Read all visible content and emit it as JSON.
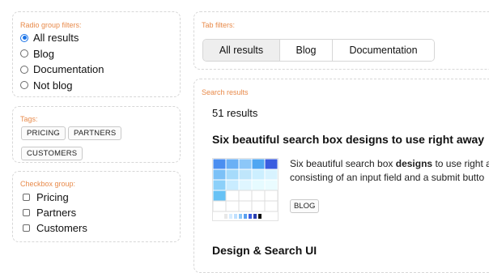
{
  "radio_group": {
    "label": "Radio group filters:",
    "options": [
      {
        "label": "All results",
        "checked": true
      },
      {
        "label": "Blog",
        "checked": false
      },
      {
        "label": "Documentation",
        "checked": false
      },
      {
        "label": "Not blog",
        "checked": false
      }
    ]
  },
  "tags": {
    "label": "Tags:",
    "items": [
      "PRICING",
      "PARTNERS",
      "CUSTOMERS"
    ]
  },
  "checkbox_group": {
    "label": "Checkbox group:",
    "options": [
      {
        "label": "Pricing",
        "checked": false
      },
      {
        "label": "Partners",
        "checked": false
      },
      {
        "label": "Customers",
        "checked": false
      }
    ]
  },
  "tab_filters": {
    "label": "Tab filters:",
    "tabs": [
      {
        "label": "All results",
        "active": true
      },
      {
        "label": "Blog",
        "active": false
      },
      {
        "label": "Documentation",
        "active": false
      }
    ]
  },
  "search_results": {
    "label": "Search results",
    "count": "51 results",
    "results": [
      {
        "title": "Six beautiful search box designs to use right away",
        "snippet_line1_pre": "Six beautiful search box ",
        "snippet_line1_bold": "designs",
        "snippet_line1_post": " to use right a",
        "snippet_line2": "consisting of an input field and a submit butto",
        "tag": "BLOG"
      },
      {
        "title": "Design & Search UI"
      }
    ]
  },
  "colors": {
    "label_accent": "#e88a4a",
    "radio_accent": "#1a73e8",
    "active_tab_bg": "#eeeeee"
  }
}
